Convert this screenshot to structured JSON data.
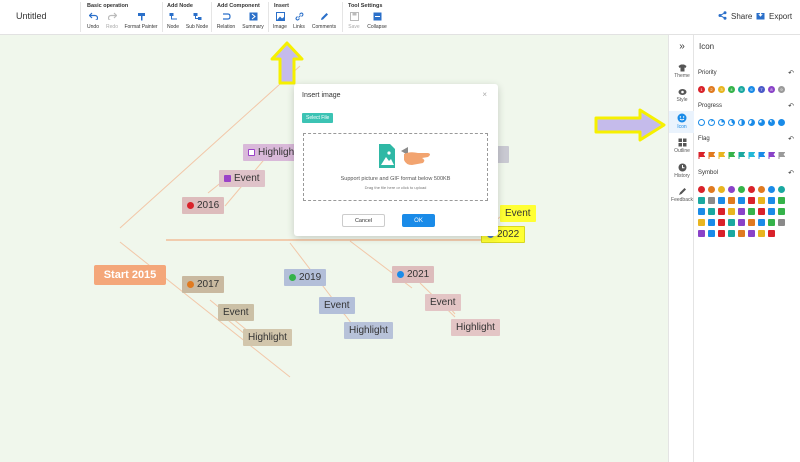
{
  "title": "Untitled",
  "toolbar": {
    "groups": {
      "basic": "Basic operation",
      "add_node": "Add Node",
      "add_component": "Add Component",
      "insert": "Insert",
      "tool_settings": "Tool Settings"
    },
    "tools": {
      "undo": "Undo",
      "redo": "Redo",
      "format_painter": "Format Painter",
      "node": "Node",
      "sub_node": "Sub Node",
      "relation": "Relation",
      "summary": "Summary",
      "image": "Image",
      "links": "Links",
      "comments": "Comments",
      "save": "Save",
      "collapse": "Collapse"
    },
    "share": "Share",
    "export": "Export"
  },
  "mindmap": {
    "root": "Start 2015",
    "n2016": "2016",
    "n2016_event": "Event",
    "n2016_highlight": "Highlight",
    "n2017": "2017",
    "n2017_event": "Event",
    "n2017_highlight": "Highlight",
    "n2019": "2019",
    "n2019_event": "Event",
    "n2019_highlight": "Highlight",
    "n2021": "2021",
    "n2021_event": "Event",
    "n2021_highlight": "Highlight",
    "n2022": "2022",
    "n2022_event": "Event"
  },
  "dialog": {
    "title": "Insert image",
    "close": "×",
    "select_file": "Select File",
    "hint": "Support picture and GIF format below 500KB",
    "subhint": "Drag the file here or click to upload",
    "cancel": "Cancel",
    "ok": "OK"
  },
  "sidebar_tabs": {
    "collapse": "»",
    "theme": "Theme",
    "style": "Style",
    "icon": "Icon",
    "outline": "Outline",
    "history": "History",
    "feedback": "Feedback"
  },
  "panel": {
    "title": "Icon",
    "priority": "Priority",
    "progress": "Progress",
    "flag": "Flag",
    "symbol": "Symbol"
  },
  "colors": {
    "accent": "#1a8be8",
    "root": "#f4a77a",
    "canvas": "#f0f7ec",
    "highlight_yellow": "#ffff33",
    "callout_arrow": "#c5bbeb"
  }
}
